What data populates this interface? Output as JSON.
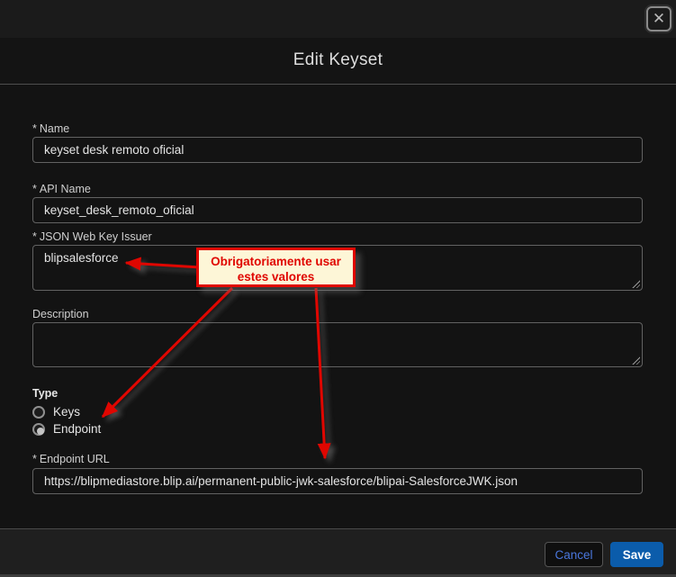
{
  "colors": {
    "accent-red": "#e00600",
    "annotation-bg": "#fdf6d7",
    "save-blue": "#0b5cab",
    "cancel-text": "#4a77dd"
  },
  "window": {
    "close_icon": "✕"
  },
  "modal": {
    "title": "Edit Keyset",
    "required_mark": "*",
    "fields": {
      "name": {
        "label": "Name",
        "value": "keyset desk remoto oficial"
      },
      "api_name": {
        "label": "API Name",
        "value": "keyset_desk_remoto_oficial"
      },
      "jwk_issuer": {
        "label": "JSON Web Key Issuer",
        "value": "blipsalesforce"
      },
      "description": {
        "label": "Description",
        "value": ""
      },
      "type": {
        "label": "Type",
        "options": [
          {
            "label": "Keys",
            "selected": false
          },
          {
            "label": "Endpoint",
            "selected": true
          }
        ]
      },
      "endpoint_url": {
        "label": "Endpoint URL",
        "value": "https://blipmediastore.blip.ai/permanent-public-jwk-salesforce/blipai-SalesforceJWK.json"
      }
    },
    "footer": {
      "cancel_label": "Cancel",
      "save_label": "Save"
    }
  },
  "annotation": {
    "line1": "Obrigatoriamente usar",
    "line2": "estes valores"
  }
}
